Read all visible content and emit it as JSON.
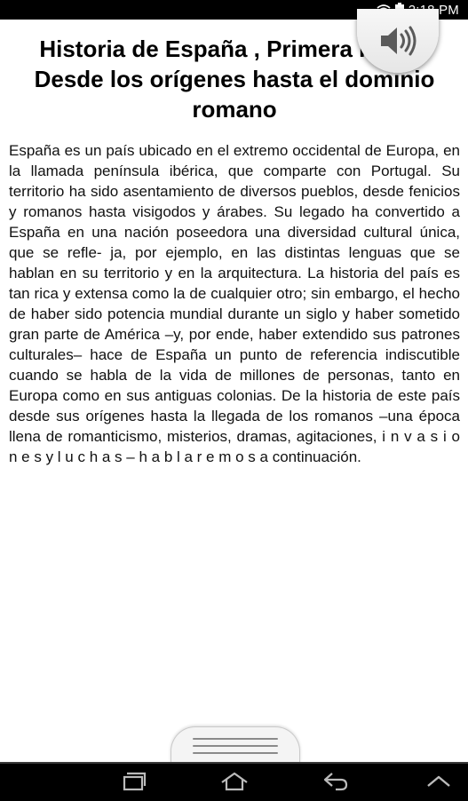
{
  "status_bar": {
    "time": "2:18 PM",
    "icons": [
      "wifi-icon",
      "battery-icon"
    ]
  },
  "document": {
    "title": "Historia de España , Primera Parte / Desde los orígenes hasta el dominio romano",
    "body": "España es un país ubicado en el extremo occidental de Europa, en la llamada península ibérica, que comparte con Portugal. Su territorio ha sido asentamiento de diversos pueblos, desde fenicios y romanos hasta visigodos y árabes. Su legado ha convertido a España en una nación poseedora una diversidad cultural única, que se refle- ja, por ejemplo, en las distintas lenguas que se hablan en su territorio y en la arquitectura. La historia del país es tan rica y extensa como la de cualquier otro; sin embargo, el hecho de haber sido potencia mundial durante un siglo y haber sometido gran parte de América –y, por ende, haber extendido sus patrones culturales– hace de España un punto de referencia indiscutible cuando se habla de la vida de millones de personas, tanto en Europa como en sus antiguas colonias. De la historia de este país desde sus orígenes hasta la llegada de los romanos –una época llena de romanticismo, misterios, dramas, agitaciones, i n v a s i o n e s y l u c h a s – h a b l a r e m o s a continuación."
  },
  "controls": {
    "audio_icon": "speaker-icon",
    "drawer_icon": "drawer-handle-icon"
  },
  "nav_bar": {
    "icons": [
      "recent-apps-icon",
      "home-icon",
      "back-icon",
      "menu-up-icon"
    ]
  },
  "colors": {
    "status_bar": "#000000",
    "page_background": "#ffffff",
    "text": "#111111"
  }
}
